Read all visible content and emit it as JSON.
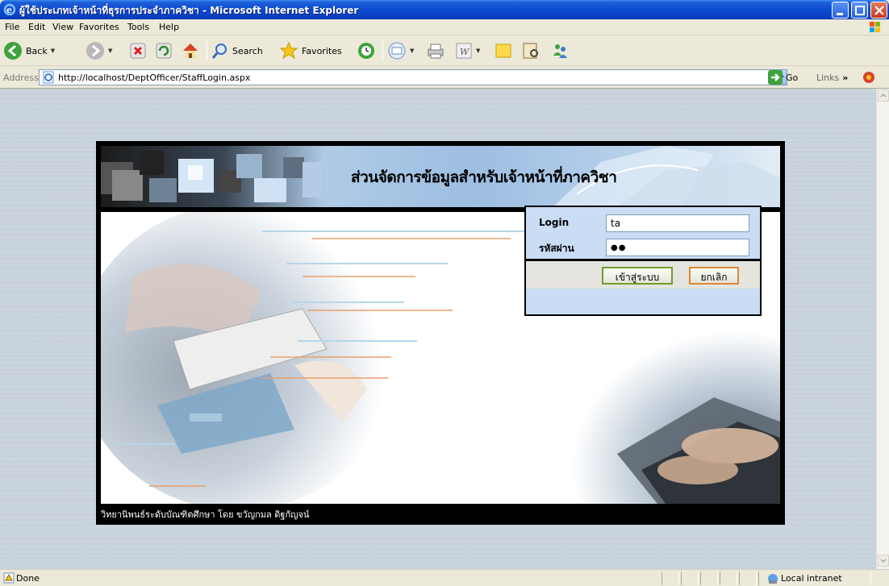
{
  "window": {
    "title": "ผู้ใช้ประเภทเจ้าหน้าที่ธุรการประจำภาควิชา - Microsoft Internet Explorer"
  },
  "menu": {
    "items": [
      "File",
      "Edit",
      "View",
      "Favorites",
      "Tools",
      "Help"
    ]
  },
  "toolbar": {
    "back_label": "Back",
    "search_label": "Search",
    "favorites_label": "Favorites"
  },
  "address": {
    "label": "Address",
    "url": "http://localhost/DeptOfficer/StaffLogin.aspx",
    "go_label": "Go",
    "links_label": "Links"
  },
  "page": {
    "banner_title": "ส่วนจัดการข้อมูลสำหรับเจ้าหน้าที่ภาควิชา",
    "login": {
      "username_label": "Login",
      "username_value": "ta",
      "password_label": "รหัสผ่าน",
      "password_value": "●●",
      "submit_label": "เข้าสู่ระบบ",
      "cancel_label": "ยกเลิก"
    },
    "footer_text": "วิทยานิพนธ์ระดับบัณฑิตศึกษา โดย ขวัญกมล ดิฐกัญจน์"
  },
  "status": {
    "text": "Done",
    "zone": "Local intranet"
  },
  "colors": {
    "titlebar": "#0A4BD0",
    "chrome": "#ECE9D8",
    "login_panel": "#C9DDF5",
    "submit_border": "#6D9E2C",
    "cancel_border": "#D88A3A"
  }
}
